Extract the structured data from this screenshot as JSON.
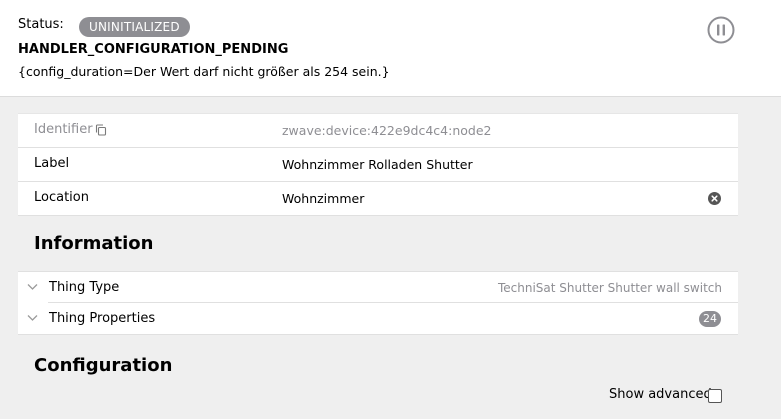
{
  "status": {
    "label": "Status:",
    "badge": "UNINITIALIZED",
    "detail": "HANDLER_CONFIGURATION_PENDING",
    "message": "{config_duration=Der Wert darf nicht größer als 254 sein.}",
    "pause_icon": "pause-circle-icon"
  },
  "properties": {
    "identifier_label": "Identifier",
    "identifier_value": "zwave:device:422e9dc4c4:node2",
    "label_label": "Label",
    "label_value": "Wohnzimmer Rolladen Shutter",
    "location_label": "Location",
    "location_value": "Wohnzimmer"
  },
  "information": {
    "title": "Information",
    "thing_type_label": "Thing Type",
    "thing_type_value": "TechniSat Shutter Shutter wall switch",
    "thing_properties_label": "Thing Properties",
    "thing_properties_count": "24"
  },
  "configuration": {
    "title": "Configuration",
    "show_advanced_label": "Show advanced",
    "show_advanced_checked": false
  },
  "colors": {
    "badge": "#8e8e93",
    "background": "#efefef"
  }
}
